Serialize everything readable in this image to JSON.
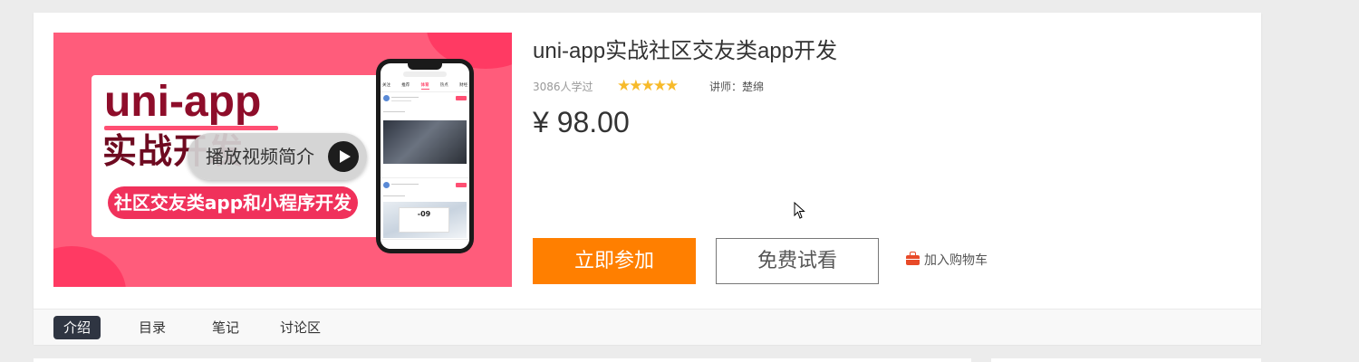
{
  "course": {
    "title": "uni-app实战社区交友类app开发",
    "learners": "3086人学过",
    "rating_stars": 5,
    "teacher": "讲师：楚绵",
    "price": "¥ 98.00"
  },
  "cover": {
    "headline": "uni-app",
    "subheadline": "实战开发",
    "pill_text": "社区交友类app和小程序开发",
    "play_label": "播放视频简介",
    "phone_tabs": [
      "关注",
      "推荐",
      "体育",
      "热点",
      "财经"
    ],
    "phone_banner": "-09",
    "colors": {
      "bg": "#ff5c7b",
      "accent": "#ff3a63",
      "headline": "#8e0d2a"
    }
  },
  "actions": {
    "join_label": "立即参加",
    "trial_label": "免费试看",
    "cart_label": "加入购物车"
  },
  "tabs": [
    {
      "label": "介绍",
      "active": true
    },
    {
      "label": "目录",
      "active": false
    },
    {
      "label": "笔记",
      "active": false
    },
    {
      "label": "讨论区",
      "active": false
    }
  ],
  "colors": {
    "join_button": "#ff7f00",
    "star": "#f7ba2a",
    "active_tab": "#2f3542",
    "cart_icon": "#e84a28"
  }
}
